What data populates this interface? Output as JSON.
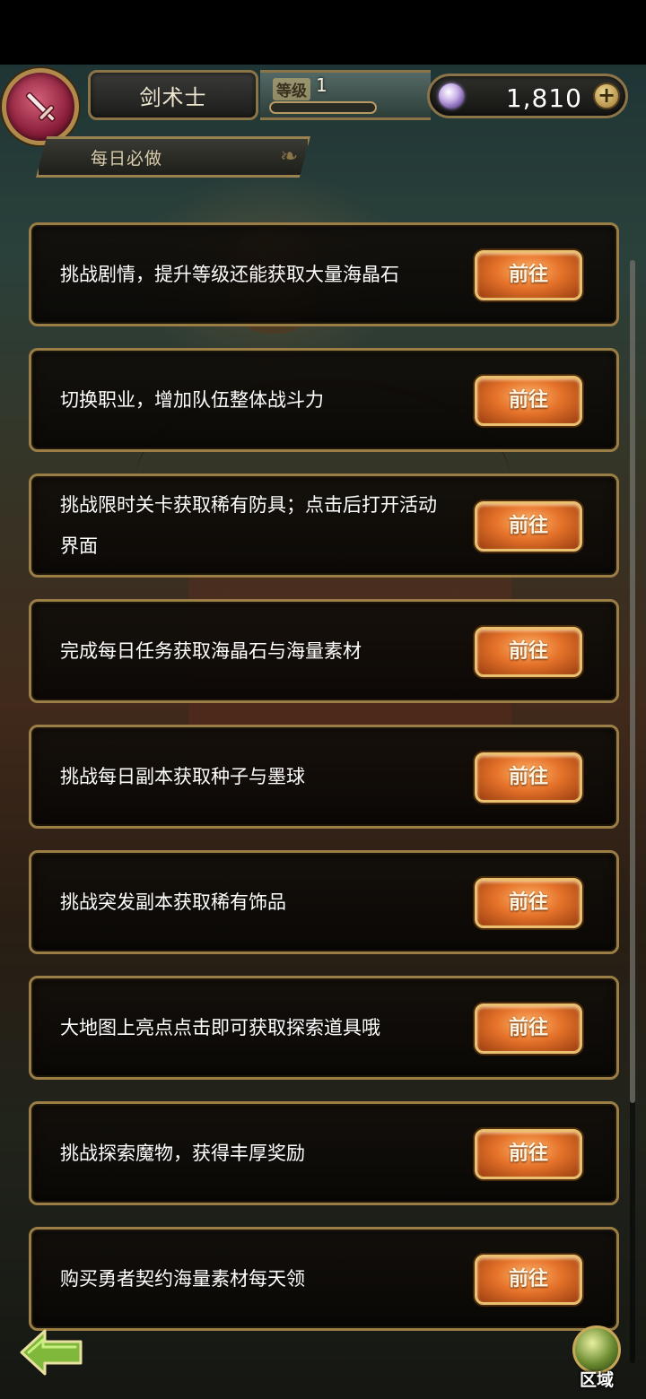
{
  "header": {
    "class_name": "剑术士",
    "level_label": "等级",
    "level_value": "1",
    "level_progress": 0.0,
    "gems": "1,810",
    "add_symbol": "+"
  },
  "section": {
    "tab_label": "每日必做"
  },
  "tasks": [
    {
      "text": "挑战剧情，提升等级还能获取大量海晶石",
      "button": "前往"
    },
    {
      "text": "切换职业，增加队伍整体战斗力",
      "button": "前往"
    },
    {
      "text": "挑战限时关卡获取稀有防具；点击后打开活动界面",
      "button": "前往"
    },
    {
      "text": "完成每日任务获取海晶石与海量素材",
      "button": "前往"
    },
    {
      "text": "挑战每日副本获取种子与墨球",
      "button": "前往"
    },
    {
      "text": "挑战突发副本获取稀有饰品",
      "button": "前往"
    },
    {
      "text": "大地图上亮点点击即可获取探索道具哦",
      "button": "前往"
    },
    {
      "text": "挑战探索魔物，获得丰厚奖励",
      "button": "前往"
    },
    {
      "text": "购买勇者契约海量素材每天领",
      "button": "前往"
    }
  ],
  "footer": {
    "region_label": "区域"
  },
  "icons": {
    "emblem": "sword-icon",
    "gem": "gem-icon",
    "back": "back-arrow-icon",
    "region": "globe-icon"
  },
  "colors": {
    "button_orange": "#e6732a",
    "frame_gold": "#9a7e46",
    "emblem_crimson": "#8a1e3a"
  }
}
